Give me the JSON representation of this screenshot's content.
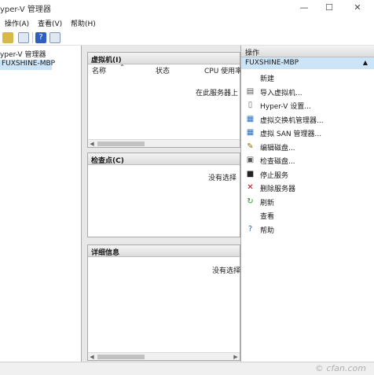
{
  "window": {
    "title": "yper-V 管理器",
    "minimize": "—",
    "maximize": "☐",
    "close": "✕"
  },
  "menu": [
    "操作(A)",
    "查看(V)",
    "帮助(H)"
  ],
  "tree": {
    "root": "yper-V 管理器",
    "server": "FUXSHINE-MBP"
  },
  "vm_panel": {
    "title": "虚拟机(I)",
    "columns": [
      "名称",
      "状态",
      "CPU 使用率"
    ],
    "message": "在此服务器上"
  },
  "checkpoint_panel": {
    "title": "检查点(C)",
    "message": "没有选择"
  },
  "details_panel": {
    "title": "详细信息",
    "message": "没有选择"
  },
  "actions": {
    "header": "操作",
    "group": "FUXSHINE-MBP",
    "items": [
      {
        "label": "新建",
        "icon": "new-icon",
        "glyph": "",
        "color": "#333"
      },
      {
        "label": "导入虚拟机...",
        "icon": "import-vm-icon",
        "glyph": "▤",
        "color": "#555"
      },
      {
        "label": "Hyper-V 设置...",
        "icon": "settings-icon",
        "glyph": "▯",
        "color": "#666"
      },
      {
        "label": "虚拟交换机管理器...",
        "icon": "switch-manager-icon",
        "glyph": "▦",
        "color": "#2a6ebb"
      },
      {
        "label": "虚拟 SAN 管理器...",
        "icon": "san-manager-icon",
        "glyph": "▦",
        "color": "#2a6ebb"
      },
      {
        "label": "编辑磁盘...",
        "icon": "edit-disk-icon",
        "glyph": "✎",
        "color": "#8a6d00"
      },
      {
        "label": "检查磁盘...",
        "icon": "inspect-disk-icon",
        "glyph": "▣",
        "color": "#555"
      },
      {
        "label": "停止服务",
        "icon": "stop-icon",
        "glyph": "■",
        "color": "#222"
      },
      {
        "label": "删除服务器",
        "icon": "delete-icon",
        "glyph": "✕",
        "color": "#d0021b"
      },
      {
        "label": "刷新",
        "icon": "refresh-icon",
        "glyph": "↻",
        "color": "#2e8b2e"
      },
      {
        "label": "查看",
        "icon": "view-icon",
        "glyph": "",
        "color": "#333"
      },
      {
        "label": "帮助",
        "icon": "help-icon",
        "glyph": "?",
        "color": "#1f5fbf"
      }
    ]
  },
  "watermark": "© cfan.com"
}
